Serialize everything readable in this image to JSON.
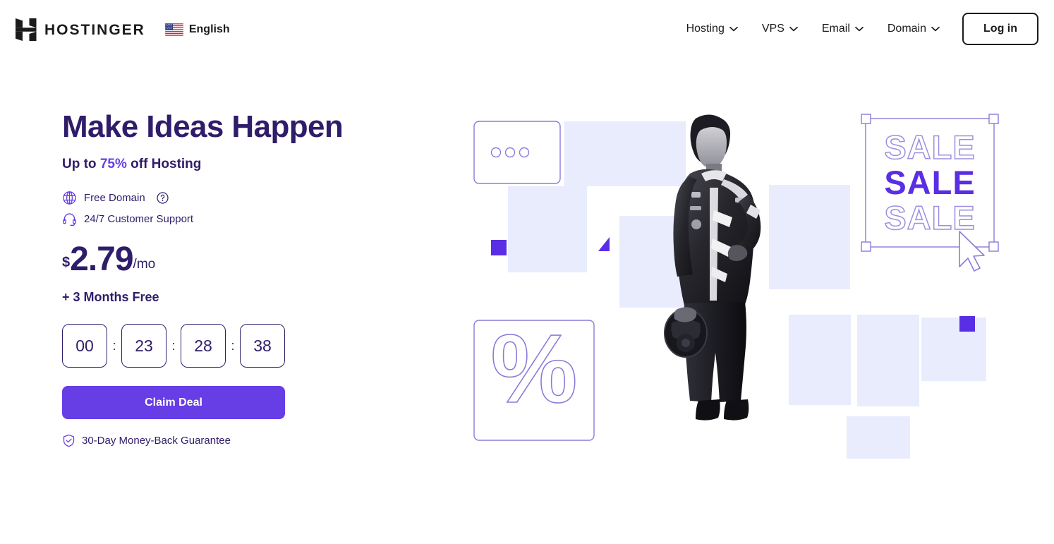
{
  "header": {
    "logo": {
      "icon": "hostinger-h-icon",
      "wordmark": "HOSTINGER"
    },
    "language": {
      "icon": "us-flag-icon",
      "label": "English"
    },
    "nav_items": [
      {
        "label": "Hosting",
        "icon": "chevron-down-icon"
      },
      {
        "label": "VPS",
        "icon": "chevron-down-icon"
      },
      {
        "label": "Email",
        "icon": "chevron-down-icon"
      },
      {
        "label": "Domain",
        "icon": "chevron-down-icon"
      }
    ],
    "login_label": "Log in"
  },
  "hero": {
    "headline": "Make Ideas Happen",
    "subhead_prefix": "Up to ",
    "subhead_accent": "75%",
    "subhead_suffix": " off Hosting",
    "features": [
      {
        "icon": "globe-icon",
        "label": "Free Domain",
        "help_icon": "question-circle-icon"
      },
      {
        "icon": "headset-icon",
        "label": "24/7 Customer Support"
      }
    ],
    "price": {
      "currency": "$",
      "amount": "2.79",
      "period": "/mo"
    },
    "bonus": "+ 3 Months Free",
    "countdown": {
      "separator": ":",
      "units": [
        "00",
        "23",
        "28",
        "38"
      ]
    },
    "cta_label": "Claim Deal",
    "guarantee": {
      "icon": "shield-check-icon",
      "label": "30-Day Money-Back Guarantee"
    }
  },
  "art": {
    "sale_text_top": "SALE",
    "sale_text_mid": "SALE",
    "sale_text_bottom": "SALE",
    "percent_glyph": "%"
  },
  "colors": {
    "brand_purple": "#673de6",
    "deep_purple": "#2f1c6a",
    "pale_lavender": "#e8ecfd",
    "outline_purple": "#8c7bd8",
    "ink": "#1b1b1b",
    "white": "#ffffff"
  }
}
